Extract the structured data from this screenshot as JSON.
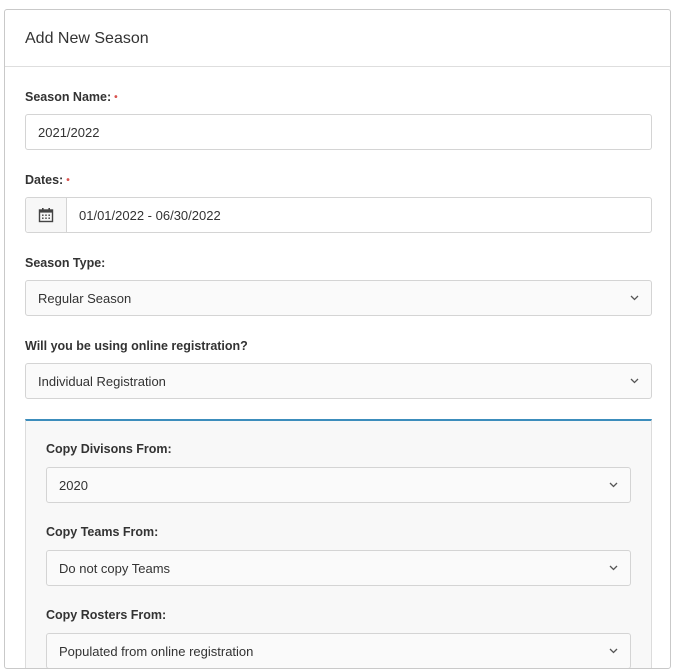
{
  "form": {
    "title": "Add New Season",
    "required_marker": "•",
    "season_name": {
      "label": "Season Name:",
      "value": "2021/2022"
    },
    "dates": {
      "label": "Dates:",
      "value": "01/01/2022 - 06/30/2022",
      "icon": "calendar-icon"
    },
    "season_type": {
      "label": "Season Type:",
      "value": "Regular Season"
    },
    "online_registration": {
      "label": "Will you be using online registration?",
      "value": "Individual Registration"
    }
  },
  "copy_panel": {
    "accent_color": "#3c8dbc",
    "divisions": {
      "label": "Copy Divisons From:",
      "value": "2020"
    },
    "teams": {
      "label": "Copy Teams From:",
      "value": "Do not copy Teams"
    },
    "rosters": {
      "label": "Copy Rosters From:",
      "value": "Populated from online registration"
    }
  },
  "colors": {
    "required": "#d9534f",
    "border": "#d4d4d4"
  }
}
